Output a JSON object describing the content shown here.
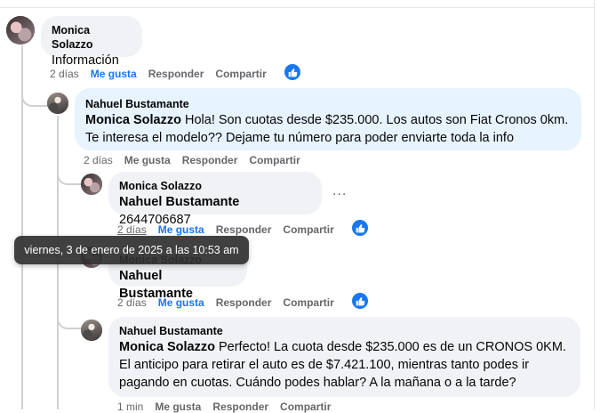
{
  "comments": [
    {
      "author": "Monica Solazzo",
      "mention": "",
      "text": "Información",
      "time": "2 días",
      "like": "Me gusta",
      "reply": "Responder",
      "share": "Compartir"
    },
    {
      "author": "Nahuel Bustamante",
      "mention": "Monica Solazzo",
      "text": " Hola! Son cuotas desde $235.000. Los autos son Fiat Cronos 0km. Te interesa el modelo?? Dejame tu número para poder enviarte toda la info",
      "time": "2 días",
      "like": "Me gusta",
      "reply": "Responder",
      "share": "Compartir"
    },
    {
      "author": "Monica Solazzo",
      "mention": "Nahuel Bustamante",
      "text": " 2644706687",
      "time": "2 días",
      "like": "Me gusta",
      "reply": "Responder",
      "share": "Compartir"
    },
    {
      "author": "Monica Solazzo",
      "mention": "Nahuel Bustamante",
      "text": "",
      "time": "2 días",
      "like": "Me gusta",
      "reply": "Responder",
      "share": "Compartir"
    },
    {
      "author": "Nahuel Bustamante",
      "mention": "Monica Solazzo",
      "text": " Perfecto! La cuota desde $235.000 es de un CRONOS 0KM. El anticipo para retirar el auto es de $7.421.100, mientras tanto podes ir pagando en cuotas. Cuándo podes hablar? A la mañana o a la tarde?",
      "time": "1 min",
      "like": "Me gusta",
      "reply": "Responder",
      "share": "Compartir"
    }
  ],
  "tooltip": "viernes, 3 de enero de 2025 a las 10:53 am",
  "more_options": "...",
  "icons": {
    "like": "thumbs-up-icon",
    "more": "more-options-icon"
  },
  "colors": {
    "accent": "#1877f2",
    "bubble": "#f0f2f5",
    "highlight": "#e7f3ff",
    "muted": "#65676b"
  }
}
